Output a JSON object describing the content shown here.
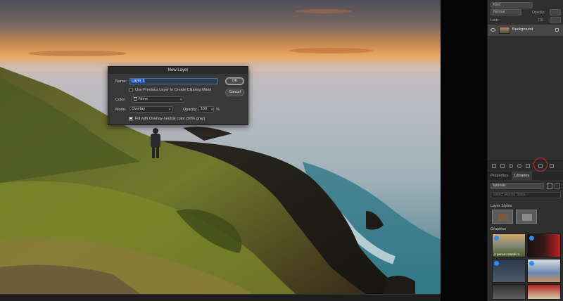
{
  "panel": {
    "search_text": "Kind",
    "blend_mode": "Normal",
    "opacity_label": "Opacity:",
    "lock_label": "Lock:",
    "fill_label": "Fill:",
    "layer_name": "Background"
  },
  "tabs": [
    {
      "label": "Properties",
      "active": false
    },
    {
      "label": "Libraries",
      "active": true
    }
  ],
  "libraries": {
    "selected_library": "tutorials",
    "search_placeholder": "Search Adobe Stock",
    "layer_styles_heading": "Layer Styles",
    "graphics_heading": "Graphics",
    "graphic_caption": "A person stands o..."
  },
  "dialog": {
    "title": "New Layer",
    "name_label": "Name:",
    "name_value": "Layer 1",
    "clipping_mask_label": "Use Previous Layer to Create Clipping Mask",
    "clipping_mask_checked": false,
    "color_label": "Color:",
    "color_value": "None",
    "mode_label": "Mode:",
    "mode_value": "Overlay",
    "opacity_label": "Opacity:",
    "opacity_value": "100",
    "opacity_unit": "%",
    "fill_neutral_label": "Fill with Overlay-neutral color (50% gray)",
    "fill_neutral_checked": true,
    "ok_label": "OK",
    "cancel_label": "Cancel"
  },
  "colors": {
    "panel_bg": "#2f2f2f",
    "accent_blue": "#1e5dc4",
    "highlight_red": "#e02020"
  }
}
